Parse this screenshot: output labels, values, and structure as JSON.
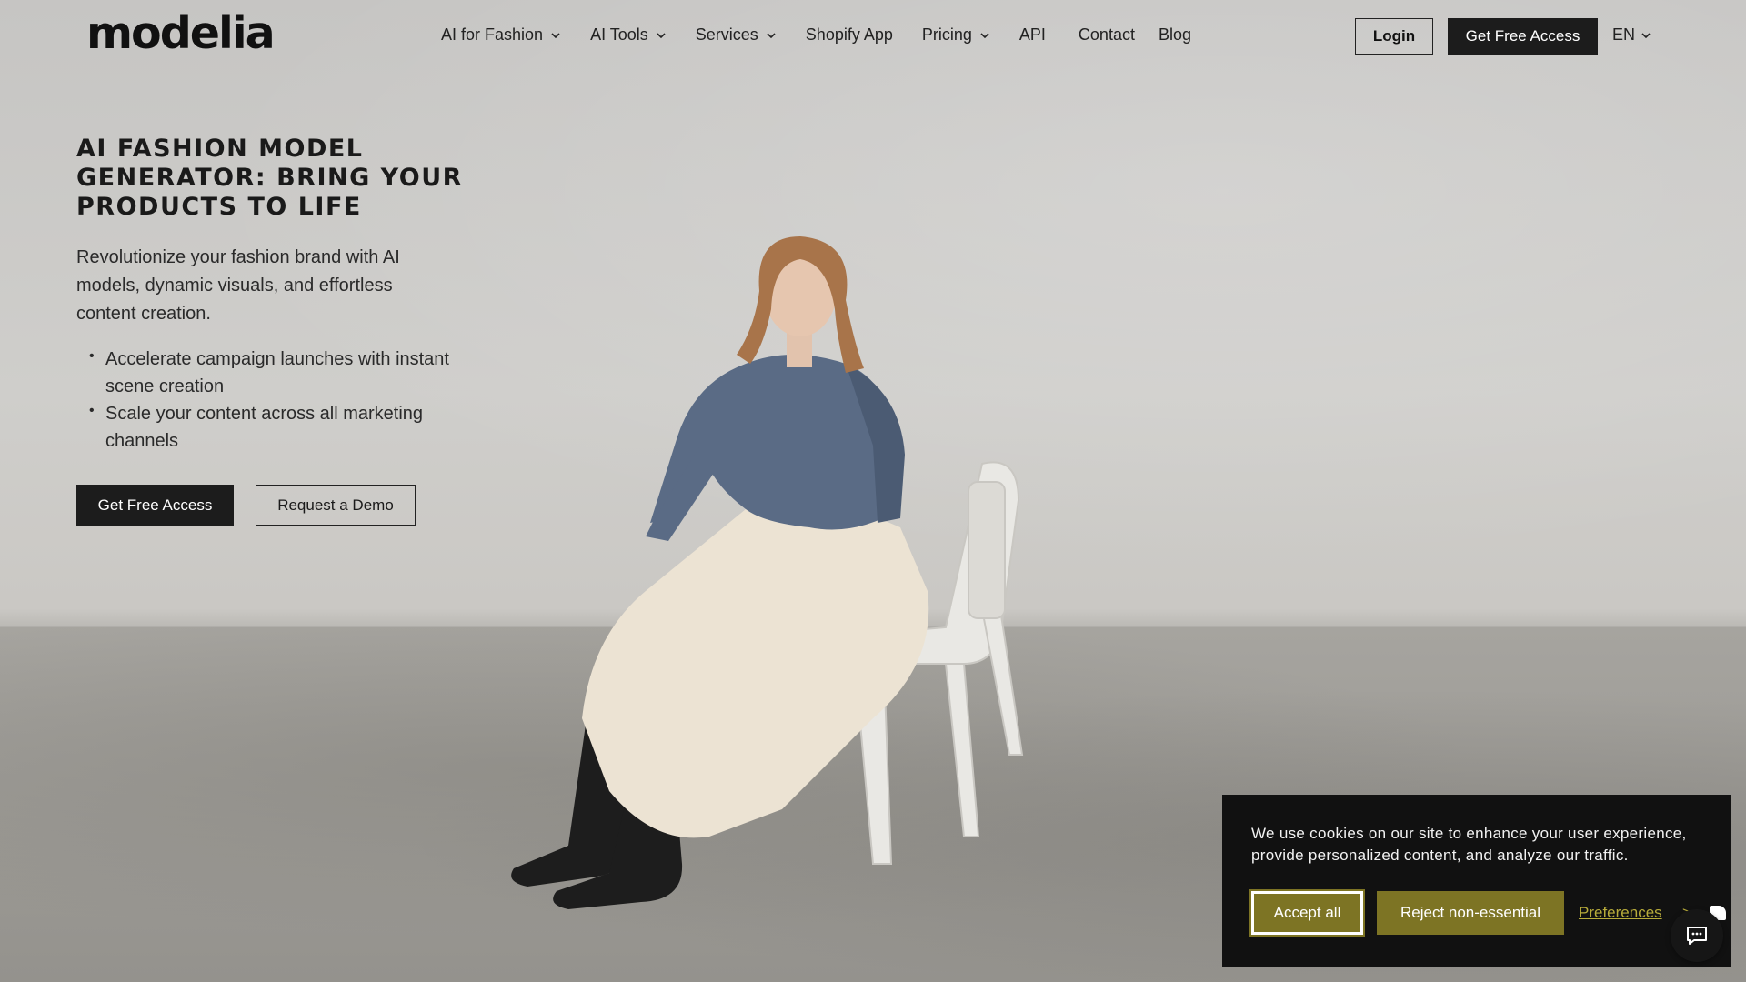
{
  "brand": {
    "logo_text": "modelia"
  },
  "nav": {
    "items": [
      {
        "label": "AI for Fashion",
        "has_dropdown": true
      },
      {
        "label": "AI Tools",
        "has_dropdown": true
      },
      {
        "label": "Services",
        "has_dropdown": true
      },
      {
        "label": "Shopify App",
        "has_dropdown": false
      },
      {
        "label": "Pricing",
        "has_dropdown": true
      },
      {
        "label": "API",
        "has_dropdown": false
      },
      {
        "label": "Contact",
        "has_dropdown": false
      },
      {
        "label": "Blog",
        "has_dropdown": false
      }
    ],
    "login_label": "Login",
    "cta_label": "Get Free Access",
    "language": "EN"
  },
  "hero": {
    "title": "AI Fashion Model Generator: Bring Your Products to Life",
    "subtitle": "Revolutionize your fashion brand with AI models, dynamic visuals, and effortless content creation.",
    "bullets": [
      "Accelerate campaign launches with instant scene creation",
      "Scale your content across all marketing channels"
    ],
    "primary_cta": "Get Free Access",
    "secondary_cta": "Request a Demo"
  },
  "cookie_banner": {
    "message": "We use cookies on our site to enhance your user experience, provide personalized content, and analyze our traffic.",
    "accept_label": "Accept all",
    "reject_label": "Reject non-essential",
    "preferences_label": "Preferences",
    "preferences_arrow": ">"
  },
  "colors": {
    "primary_dark": "#1c1c1c",
    "cookie_accent": "#7d7424",
    "cookie_link": "#b7ab3a",
    "cookie_bg": "#111111"
  },
  "icons": {
    "dropdown": "chevron-down-icon",
    "chat": "chat-icon"
  }
}
